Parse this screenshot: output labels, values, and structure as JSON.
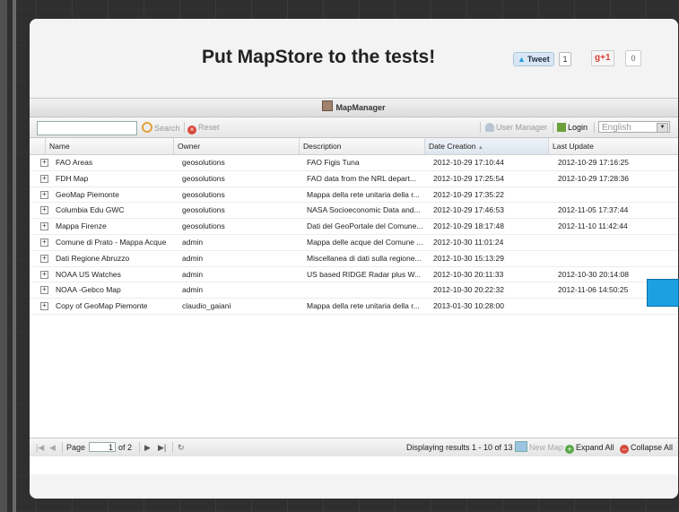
{
  "header": {
    "title": "Put MapStore to the tests!",
    "tweet_label": "Tweet",
    "tweet_count": "1",
    "gplus_label": "+1",
    "gplus_count": "0"
  },
  "panel": {
    "title": "MapManager",
    "toolbar": {
      "search_placeholder": "",
      "search_label": "Search",
      "reset_label": "Reset",
      "user_manager_label": "User Manager",
      "login_label": "Login",
      "language": "English"
    },
    "columns": [
      "Name",
      "Owner",
      "Description",
      "Date Creation",
      "Last Update"
    ],
    "rows": [
      {
        "name": "FAO Areas",
        "owner": "geosolutions",
        "description": "FAO Figis Tuna",
        "created": "2012-10-29 17:10:44",
        "updated": "2012-10-29 17:16:25"
      },
      {
        "name": "FDH Map",
        "owner": "geosolutions",
        "description": "FAO data from the NRL depart...",
        "created": "2012-10-29 17:25:54",
        "updated": "2012-10-29 17:28:36"
      },
      {
        "name": "GeoMap Piemonte",
        "owner": "geosolutions",
        "description": "Mappa della rete unitaria della r...",
        "created": "2012-10-29 17:35:22",
        "updated": ""
      },
      {
        "name": "Columbia Edu GWC",
        "owner": "geosolutions",
        "description": "NASA Socioeconomic Data and...",
        "created": "2012-10-29 17:46:53",
        "updated": "2012-11-05 17:37:44"
      },
      {
        "name": "Mappa Firenze",
        "owner": "geosolutions",
        "description": "Dati del GeoPortale del Comune...",
        "created": "2012-10-29 18:17:48",
        "updated": "2012-11-10 11:42:44"
      },
      {
        "name": "Comune di Prato - Mappa Acque",
        "owner": "admin",
        "description": "Mappa delle acque del Comune ...",
        "created": "2012-10-30 11:01:24",
        "updated": ""
      },
      {
        "name": "Dati Regione Abruzzo",
        "owner": "admin",
        "description": "Miscellanea di dati sulla regione...",
        "created": "2012-10-30 15:13:29",
        "updated": ""
      },
      {
        "name": "NOAA US Watches",
        "owner": "admin",
        "description": "US based RIDGE Radar plus W...",
        "created": "2012-10-30 20:11:33",
        "updated": "2012-10-30 20:14:08"
      },
      {
        "name": "NOAA -Gebco Map",
        "owner": "admin",
        "description": "",
        "created": "2012-10-30 20:22:32",
        "updated": "2012-11-06 14:50:25"
      },
      {
        "name": "Copy of GeoMap Piemonte",
        "owner": "claudio_gaiani",
        "description": "Mappa della rete unitaria della r...",
        "created": "2013-01-30 10:28:00",
        "updated": ""
      }
    ],
    "pager": {
      "page_label": "Page",
      "page_value": "1",
      "of_label": "of 2",
      "displaying": "Displaying results 1 - 10 of 13",
      "new_map": "New Map",
      "expand_all": "Expand All",
      "collapse_all": "Collapse All"
    }
  }
}
